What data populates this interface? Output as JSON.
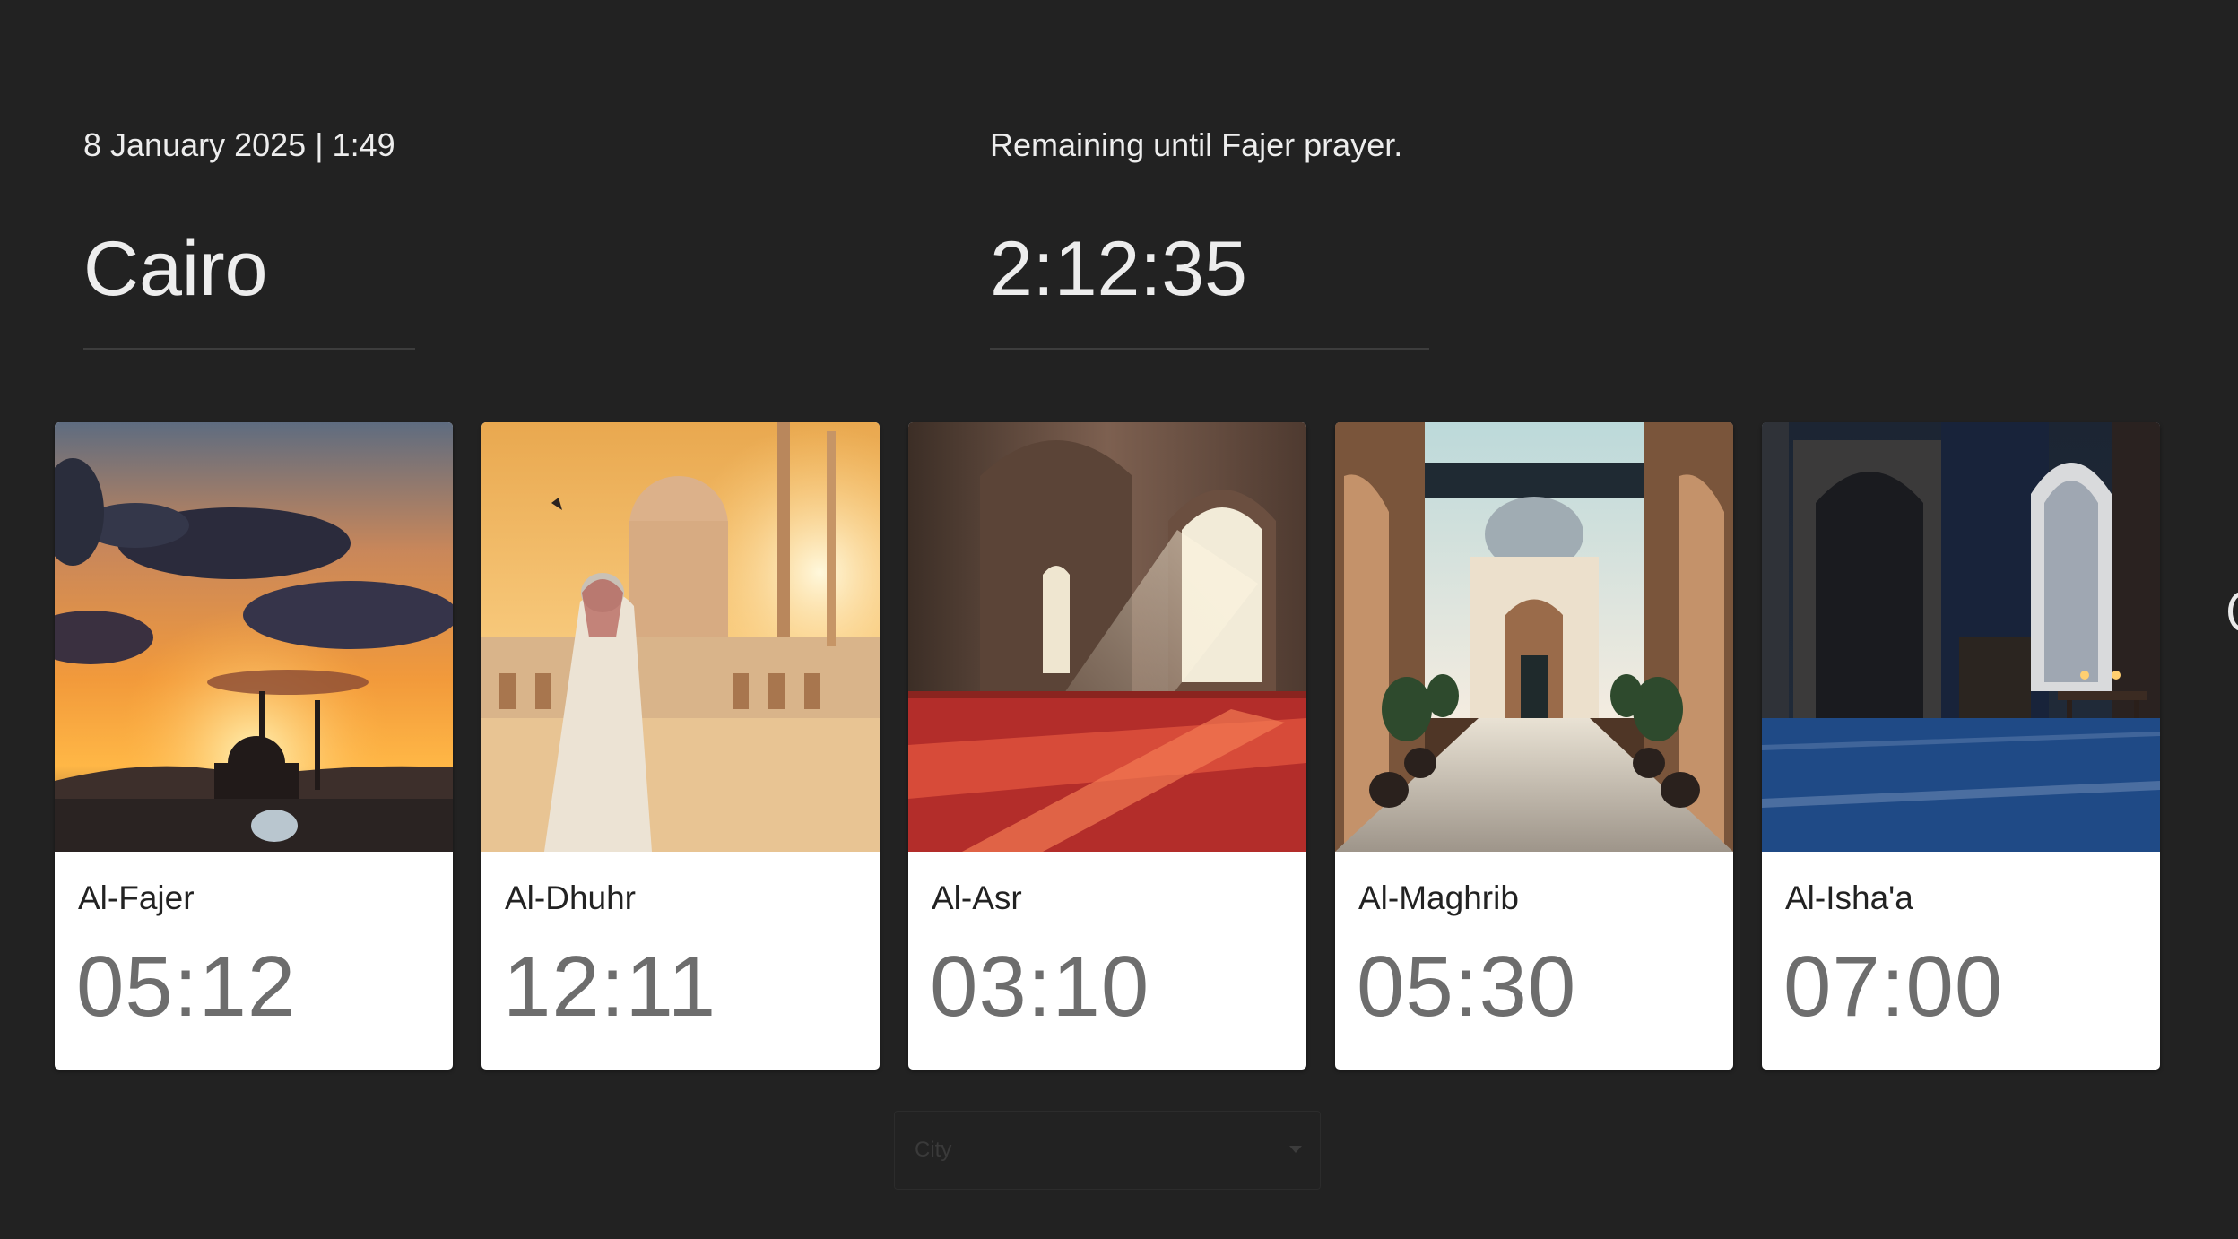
{
  "header": {
    "date_time": "8 January 2025 | 1:49",
    "city": "Cairo",
    "remaining_label": "Remaining until Fajer prayer.",
    "countdown": "2:12:35"
  },
  "prayers": [
    {
      "name": "Al-Fajer",
      "time": "05:12",
      "image": "mosque-sunset-silhouette"
    },
    {
      "name": "Al-Dhuhr",
      "time": "12:11",
      "image": "man-praying-before-mosque"
    },
    {
      "name": "Al-Asr",
      "time": "03:10",
      "image": "mosque-interior-sunlight"
    },
    {
      "name": "Al-Maghrib",
      "time": "05:30",
      "image": "mosque-courtyard"
    },
    {
      "name": "Al-Isha'a",
      "time": "07:00",
      "image": "mosque-interior-night"
    }
  ],
  "city_select": {
    "placeholder": "City"
  },
  "colors": {
    "background": "#222222",
    "card": "#ffffff",
    "time_text": "#6d6d6d"
  }
}
